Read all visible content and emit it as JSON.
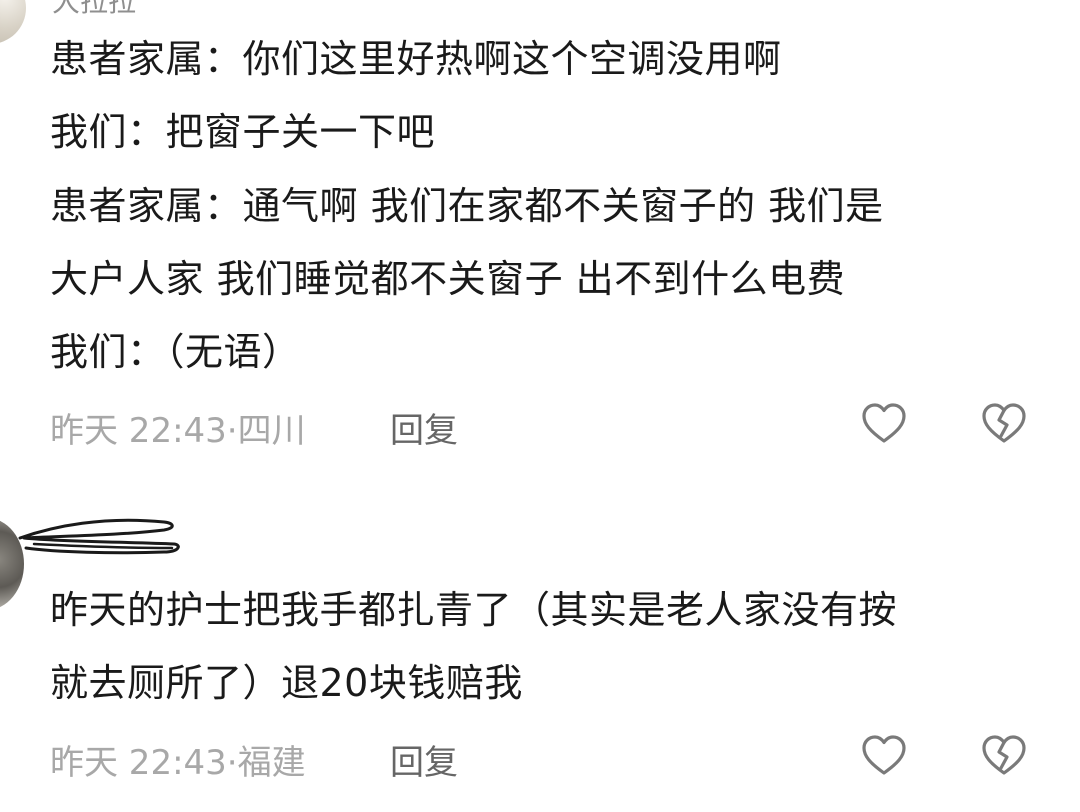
{
  "comments": [
    {
      "username": "大拉拉",
      "lines": [
        "患者家属：你们这里好热啊这个空调没用啊",
        "我们：把窗子关一下吧",
        "患者家属：通气啊 我们在家都不关窗子的 我们是",
        "大户人家 我们睡觉都不关窗子 出不到什么电费",
        "我们：（无语）"
      ],
      "time": "昨天 22:43",
      "location": "四川",
      "reply_label": "回复"
    },
    {
      "lines": [
        "昨天的护士把我手都扎青了（其实是老人家没有按",
        "就去厕所了）退20块钱赔我"
      ],
      "time": "昨天 22:43",
      "location": "福建",
      "reply_label": "回复"
    }
  ],
  "meta_separator": "·",
  "icons": {
    "like": "heart-icon",
    "dislike": "broken-heart-icon"
  },
  "colors": {
    "text": "#1a1a1a",
    "meta": "#a8a8a8",
    "reply": "#666666",
    "icon": "#7a7a7a"
  }
}
